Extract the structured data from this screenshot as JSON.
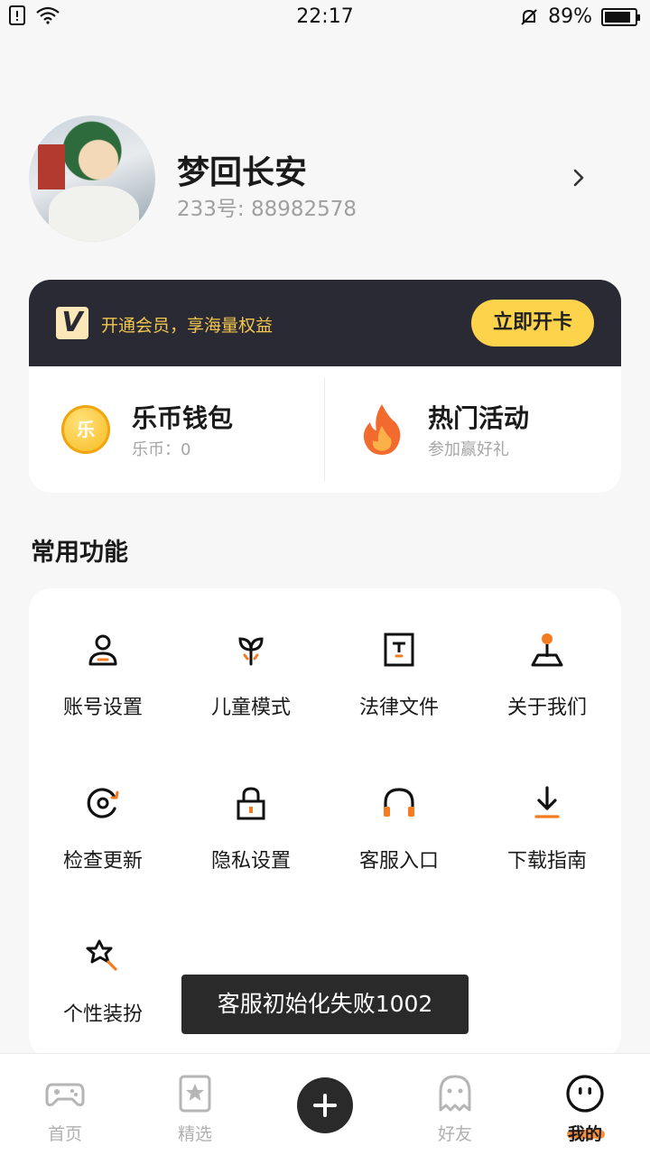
{
  "status_bar": {
    "time": "22:17",
    "battery": "89%",
    "battery_level": 0.89,
    "icons": [
      "sim-warning-icon",
      "wifi-icon",
      "mute-icon",
      "battery-icon"
    ]
  },
  "profile": {
    "name": "梦回长安",
    "uid": "233号: 88982578"
  },
  "vip": {
    "promo_text": "开通会员，享海量权益",
    "button_label": "立即开卡",
    "logo_letter": "V"
  },
  "wallet": {
    "title": "乐币钱包",
    "sub": "乐币：0",
    "coin_glyph": "乐"
  },
  "activity": {
    "title": "热门活动",
    "sub": "参加赢好礼"
  },
  "section": {
    "title": "常用功能"
  },
  "functions": [
    {
      "label": "账号设置",
      "icon": "account-icon"
    },
    {
      "label": "儿童模式",
      "icon": "sprout-icon"
    },
    {
      "label": "法律文件",
      "icon": "document-icon"
    },
    {
      "label": "关于我们",
      "icon": "joystick-icon"
    },
    {
      "label": "检查更新",
      "icon": "update-icon"
    },
    {
      "label": "隐私设置",
      "icon": "lock-icon"
    },
    {
      "label": "客服入口",
      "icon": "headphone-icon"
    },
    {
      "label": "下载指南",
      "icon": "download-icon"
    },
    {
      "label": "个性装扮",
      "icon": "magic-wand-icon"
    }
  ],
  "toast": "客服初始化失败1002",
  "bottom_nav": {
    "items": [
      {
        "label": "首页",
        "icon": "gamepad-icon"
      },
      {
        "label": "精选",
        "icon": "star-bookmark-icon"
      },
      {
        "label": "好友",
        "icon": "ghost-icon"
      },
      {
        "label": "我的",
        "icon": "face-icon"
      }
    ],
    "active": "我的"
  },
  "colors": {
    "accent": "#f47b20",
    "vip_gold": "#fcd34b",
    "dark": "#2a2a35"
  }
}
